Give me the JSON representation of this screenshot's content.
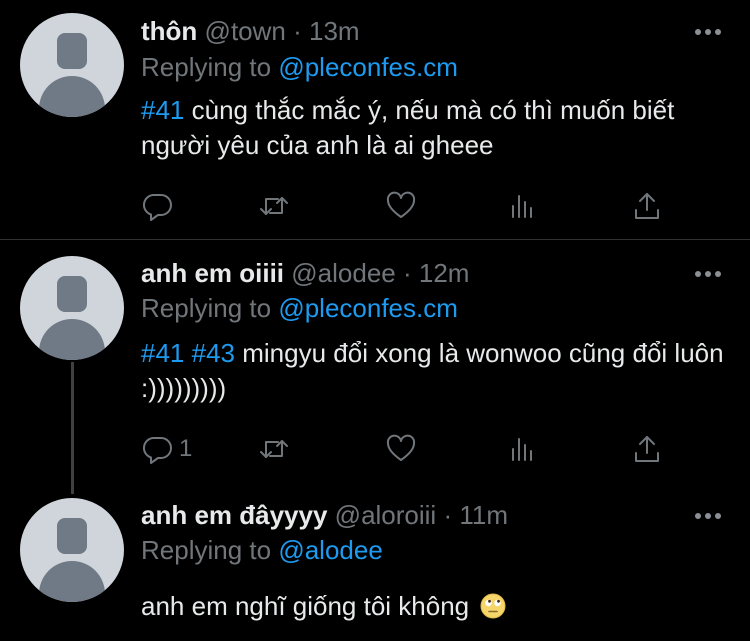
{
  "tweets": [
    {
      "name": "thôn",
      "handle": "@town",
      "time": "13m",
      "reply_prefix": "Replying to ",
      "reply_to": "@pleconfes.cm",
      "hashtags": [
        "#41"
      ],
      "text": "cùng thắc mắc ý, nếu mà có thì muốn biết người yêu của anh là ai gheee",
      "reply_count": ""
    },
    {
      "name": "anh em oiiii",
      "handle": "@alodee",
      "time": "12m",
      "reply_prefix": "Replying to ",
      "reply_to": "@pleconfes.cm",
      "hashtags": [
        "#41",
        "#43"
      ],
      "text": "mingyu đổi xong là wonwoo cũng đổi luôn :)))))))))",
      "reply_count": "1"
    },
    {
      "name": "anh em đâyyyy",
      "handle": "@aloroiii",
      "time": "11m",
      "reply_prefix": "Replying to ",
      "reply_to": "@alodee",
      "hashtags": [],
      "text": "anh em nghĩ giống tôi không",
      "emoji": "rolling-eyes-emoji"
    }
  ],
  "separator": " · ",
  "icons": {
    "reply": "reply-icon",
    "retweet": "retweet-icon",
    "like": "heart-icon",
    "views": "analytics-icon",
    "share": "share-icon",
    "more": "more-icon"
  },
  "colors": {
    "background": "#000000",
    "text": "#e7e9ea",
    "muted": "#71767b",
    "accent": "#1d9bf0",
    "divider": "#2f3336"
  }
}
